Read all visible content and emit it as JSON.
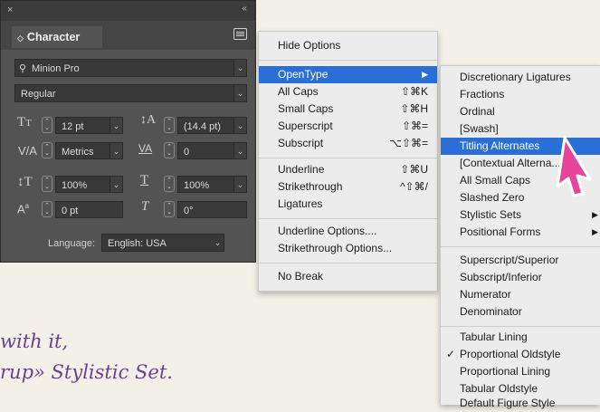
{
  "panel": {
    "close_glyph": "×",
    "collapse_glyph": "‹‹",
    "tab_label": "Character",
    "tab_arrow": "◇",
    "font_family": "Minion Pro",
    "font_style": "Regular",
    "font_size": "12 pt",
    "leading": "(14.4 pt)",
    "kerning": "Metrics",
    "tracking": "0",
    "vertical_scale": "100%",
    "horizontal_scale": "100%",
    "baseline_shift": "0 pt",
    "skew": "0°",
    "language_label": "Language:",
    "language_value": "English: USA"
  },
  "main_menu": {
    "items": [
      {
        "label": "Hide Options",
        "shortcut": ""
      },
      {
        "label": "OpenType",
        "shortcut": "▶"
      },
      {
        "label": "All Caps",
        "shortcut": "⇧⌘K"
      },
      {
        "label": "Small Caps",
        "shortcut": "⇧⌘H"
      },
      {
        "label": "Superscript",
        "shortcut": "⇧⌘="
      },
      {
        "label": "Subscript",
        "shortcut": "⌥⇧⌘="
      },
      {
        "label": "Underline",
        "shortcut": "⇧⌘U"
      },
      {
        "label": "Strikethrough",
        "shortcut": "^⇧⌘/"
      },
      {
        "label": "Ligatures",
        "shortcut": ""
      },
      {
        "label": "Underline Options....",
        "shortcut": ""
      },
      {
        "label": "Strikethrough Options...",
        "shortcut": ""
      },
      {
        "label": "No Break",
        "shortcut": ""
      }
    ]
  },
  "submenu": {
    "items": [
      {
        "label": "Discretionary Ligatures"
      },
      {
        "label": "Fractions"
      },
      {
        "label": "Ordinal"
      },
      {
        "label": "[Swash]"
      },
      {
        "label": "Titling Alternates"
      },
      {
        "label": "[Contextual Alterna...]"
      },
      {
        "label": "All Small Caps"
      },
      {
        "label": "Slashed Zero"
      },
      {
        "label": "Stylistic Sets"
      },
      {
        "label": "Positional Forms"
      },
      {
        "label": "Superscript/Superior"
      },
      {
        "label": "Subscript/Inferior"
      },
      {
        "label": "Numerator"
      },
      {
        "label": "Denominator"
      },
      {
        "label": "Tabular Lining"
      },
      {
        "label": "Proportional Oldstyle"
      },
      {
        "label": "Proportional Lining"
      },
      {
        "label": "Tabular Oldstyle"
      },
      {
        "label": "Default Figure Style"
      }
    ],
    "checkmark": "✓",
    "arrow": "▶"
  },
  "background_text": {
    "line1": "with it,",
    "line2": "rup» Stylistic Set."
  },
  "colors": {
    "highlight": "#2a6fd8",
    "cursor": "#e6459a",
    "panel_bg": "#535353"
  }
}
